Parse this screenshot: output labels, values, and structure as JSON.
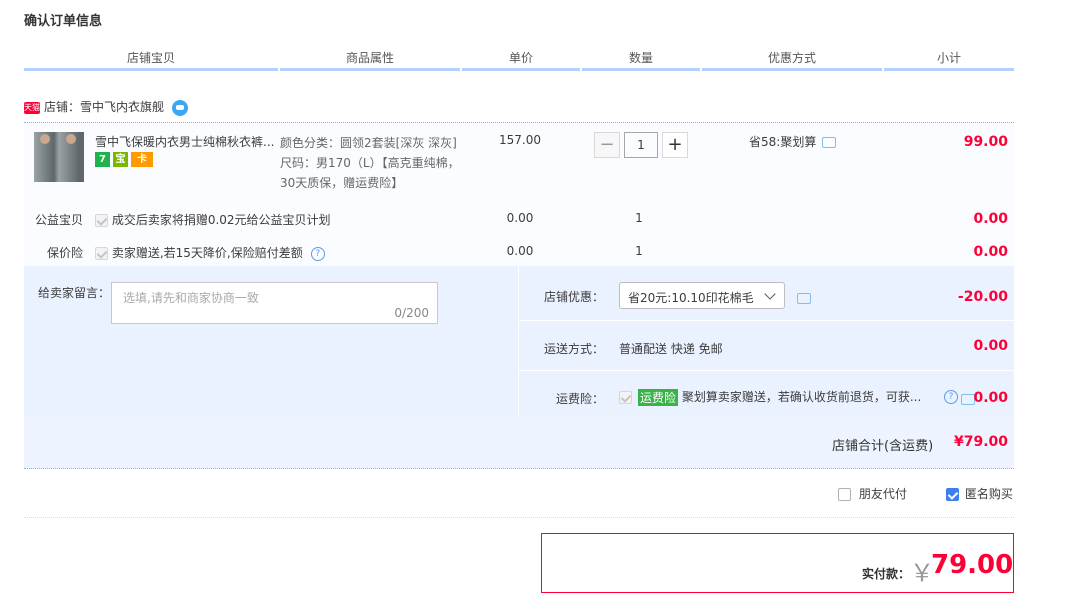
{
  "page_title": "确认订单信息",
  "columns": [
    "店铺宝贝",
    "商品属性",
    "单价",
    "数量",
    "优惠方式",
    "小计"
  ],
  "shop": {
    "badge": "天猫",
    "label": "店铺：雪中飞内衣旗舰"
  },
  "item": {
    "title": "雪中飞保暖内衣男士纯棉秋衣裤...",
    "attr_color": "颜色分类：圆领2套装[深灰 深灰]",
    "attr_size": "尺码：男170（L）【高克重纯棉，30天质保，赠运费险】",
    "price": "157.00",
    "quantity": "1",
    "minus": "−",
    "plus": "+",
    "promo": "省58:聚划算",
    "subtotal": "99.00",
    "service_icons": [
      "7",
      "宝",
      "卡"
    ]
  },
  "charity": {
    "label": "公益宝贝",
    "text": "成交后卖家将捐赠0.02元给公益宝贝计划",
    "price": "0.00",
    "qty": "1",
    "amount": "0.00"
  },
  "price_protect": {
    "label": "保价险",
    "text": "卖家赠送,若15天降价,保险赔付差额",
    "price": "0.00",
    "qty": "1",
    "amount": "0.00"
  },
  "note": {
    "label": "给卖家留言：",
    "placeholder": "选填,请先和商家协商一致",
    "count": "0/200"
  },
  "shop_discount": {
    "label": "店铺优惠：",
    "value": "省20元:10.10印花棉毛",
    "amount": "-20.00"
  },
  "shipping": {
    "label": "运送方式：",
    "value": "普通配送 快递 免邮",
    "amount": "0.00"
  },
  "freight_ins": {
    "label": "运费险：",
    "tag": "运费险",
    "text": "聚划算卖家赠送，若确认收货前退货，可获...",
    "amount": "0.00"
  },
  "shop_total": {
    "label": "店铺合计(含运费)",
    "amount": "¥79.00"
  },
  "options": {
    "friend_pay": "朋友代付",
    "anonymous": "匿名购买"
  },
  "payment": {
    "label": "实付款：",
    "currency": "￥",
    "amount": "79.00"
  },
  "colors": {
    "accent_red": "#ff0036",
    "header_line": "#b2d1ff",
    "panel_bg": "#eaf1ff"
  }
}
